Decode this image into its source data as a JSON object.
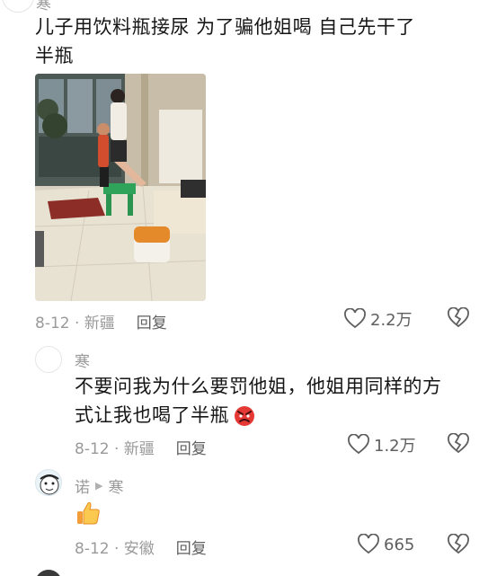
{
  "comments": [
    {
      "author": "寒",
      "text_line1": "儿子用饮料瓶接尿 为了骗他姐喝 自己先干了",
      "text_line2": "半瓶",
      "date_location": "8-12 · 新疆",
      "reply_label": "回复",
      "likes": "2.2万",
      "has_photo": true
    },
    {
      "author": "寒",
      "text_line1": "不要问我为什么要罚他姐，他姐用同样的方",
      "text_line2": "式让我也喝了半瓶",
      "emoji": "angry-face",
      "date_location": "8-12 · 新疆",
      "reply_label": "回复",
      "likes": "1.2万"
    },
    {
      "author": "诺",
      "reply_to": "寒",
      "emoji": "thumbs-up",
      "date_location": "8-12 · 安徽",
      "reply_label": "回复",
      "likes": "665"
    }
  ],
  "icons": {
    "like": "heart-outline-icon",
    "dislike": "broken-heart-icon",
    "reply_arrow": "play-triangle-icon"
  },
  "colors": {
    "text": "#161616",
    "meta": "#9a9a9a",
    "action": "#5f5f5f",
    "background": "#ffffff"
  }
}
